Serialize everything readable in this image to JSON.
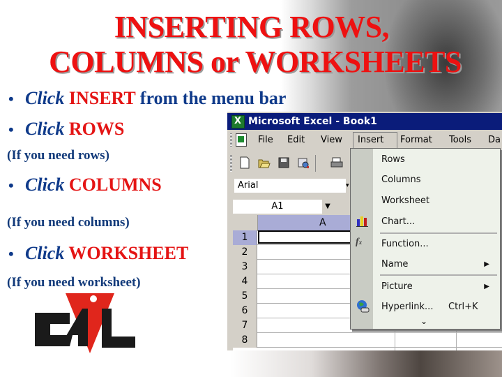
{
  "slide": {
    "title_line1": "INSERTING ROWS,",
    "title_line2": "COLUMNS or WORKSHEETS",
    "bullets": [
      {
        "bullet": "•",
        "verb": "Click",
        "keyword": "INSERT",
        "rest": "from the menu bar"
      },
      {
        "bullet": "•",
        "verb": "Click",
        "keyword": "ROWS",
        "rest": ""
      },
      {
        "bullet": "•",
        "verb": "Click",
        "keyword": "COLUMNS",
        "rest": ""
      },
      {
        "bullet": "•",
        "verb": "Click",
        "keyword": "WORKSHEET",
        "rest": ""
      }
    ],
    "notes": [
      "(If you need rows)",
      "(If you need columns)",
      "(If you need worksheet)"
    ],
    "logo_text": "CAL",
    "colors": {
      "title": "#ee1111",
      "body": "#0f3a8a",
      "keyword": "#e41414"
    }
  },
  "excel": {
    "window_title": "Microsoft Excel - Book1",
    "menu": [
      "File",
      "Edit",
      "View",
      "Insert",
      "Format",
      "Tools",
      "Da"
    ],
    "menu_active": "Insert",
    "font_name": "Arial",
    "name_box": "A1",
    "column_headers": [
      "A"
    ],
    "row_numbers": [
      "1",
      "2",
      "3",
      "4",
      "5",
      "6",
      "7",
      "8"
    ],
    "insert_menu": {
      "items": [
        {
          "label": "Rows",
          "icon": "",
          "submenu": false,
          "shortcut": ""
        },
        {
          "label": "Columns",
          "icon": "",
          "submenu": false,
          "shortcut": ""
        },
        {
          "label": "Worksheet",
          "icon": "",
          "submenu": false,
          "shortcut": ""
        },
        {
          "label": "Chart...",
          "icon": "chart-icon",
          "submenu": false,
          "shortcut": ""
        },
        {
          "label": "Function...",
          "icon": "function-icon",
          "submenu": false,
          "shortcut": ""
        },
        {
          "label": "Name",
          "icon": "",
          "submenu": true,
          "shortcut": ""
        },
        {
          "label": "Picture",
          "icon": "",
          "submenu": true,
          "shortcut": ""
        },
        {
          "label": "Hyperlink...",
          "icon": "hyperlink-globe-icon",
          "submenu": false,
          "shortcut": "Ctrl+K"
        }
      ],
      "expand_glyph": "¥",
      "submenu_glyph": "▶"
    },
    "title_bar_color": "#0a1c7a",
    "header_highlight": "#a9acd6"
  }
}
